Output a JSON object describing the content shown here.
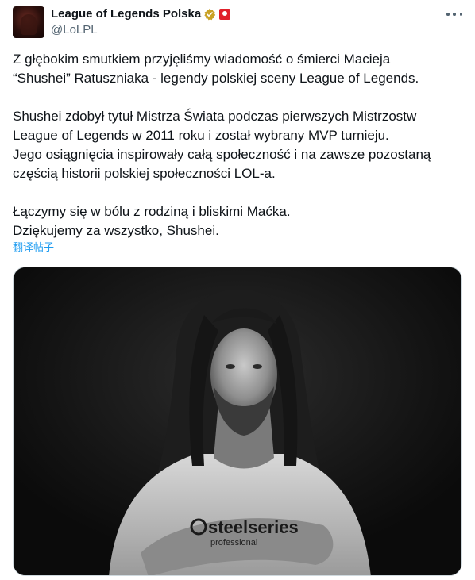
{
  "author": {
    "display_name": "League of Legends Polska",
    "handle": "@LoLPL",
    "avatar_icon": "avatar-image",
    "verified_icon": "verified-badge-icon",
    "affiliate_icon": "affiliate-badge-icon",
    "verified_color": "#c9a227",
    "affiliate_color": "#e0202a"
  },
  "menu": {
    "more_icon": "more-options-icon"
  },
  "post": {
    "paragraphs": [
      {
        "lines": [
          "Z głębokim smutkiem przyjęliśmy wiadomość o śmierci Macieja",
          "“Shushei” Ratuszniaka - legendy polskiej sceny League of Legends."
        ]
      },
      {
        "lines": [
          "Shushei zdobył tytuł Mistrza Świata podczas pierwszych Mistrzostw",
          "League of Legends w 2011 roku i został wybrany MVP turnieju.",
          "Jego osiągnięcia inspirowały całą społeczność i na zawsze pozostaną",
          "częścią historii polskiej społeczności LOL-a."
        ]
      },
      {
        "lines": [
          "Łączymy się w bólu z rodziną i bliskimi Maćka.",
          "Dziękujemy za wszystko, Shushei."
        ]
      }
    ],
    "translate_label": "翻译帖子"
  },
  "media": {
    "shirt_logo_text": "steelseries",
    "shirt_sub_text": "professional"
  },
  "colors": {
    "text": "#0f1419",
    "secondary": "#536471",
    "link": "#1d9bf0",
    "media_bg": "#111111"
  }
}
